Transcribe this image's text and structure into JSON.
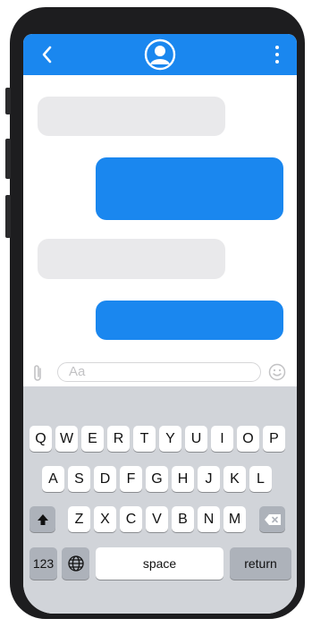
{
  "composer": {
    "placeholder": "Aa"
  },
  "keyboard": {
    "row1": [
      "Q",
      "W",
      "E",
      "R",
      "T",
      "Y",
      "U",
      "I",
      "O",
      "P"
    ],
    "row2": [
      "A",
      "S",
      "D",
      "F",
      "G",
      "H",
      "J",
      "K",
      "L"
    ],
    "row3": [
      "Z",
      "X",
      "C",
      "V",
      "B",
      "N",
      "M"
    ],
    "numbers_label": "123",
    "space_label": "space",
    "return_label": "return"
  },
  "icons": {
    "back": "chevron-left-icon",
    "avatar": "user-avatar-icon",
    "more": "more-vertical-icon",
    "attach": "paperclip-icon",
    "emoji": "smiley-icon",
    "shift": "shift-arrow-icon",
    "delete": "backspace-icon",
    "globe": "globe-icon"
  },
  "colors": {
    "accent": "#1a87ef",
    "received_bubble": "#e9e9eb",
    "keyboard_bg": "#d1d4d9"
  }
}
